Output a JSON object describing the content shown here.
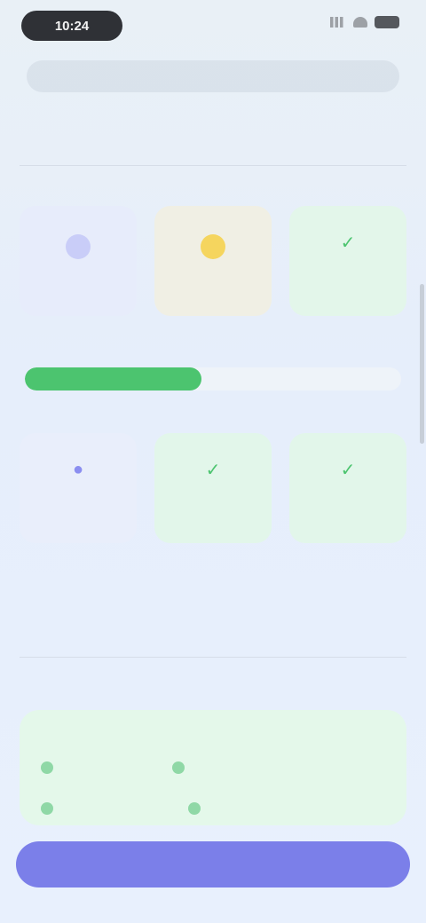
{
  "status_bar": {
    "time": "10:24"
  },
  "browser": {
    "url": ""
  },
  "section1": {
    "title": "",
    "subtitle": "",
    "cards_row1": [
      {
        "badge": "",
        "label": "",
        "accent": "#8b8ef0",
        "bg": "#e7ecfb"
      },
      {
        "badge": "",
        "label": "",
        "accent": "#f3c744",
        "bg": "#f0efe4"
      },
      {
        "icon": "check-icon",
        "label": "",
        "accent": "#6cc98a",
        "bg": "#e3f6ea"
      }
    ],
    "progress": {
      "label": "",
      "value": 0.47,
      "color": "#4cc46f"
    },
    "cards_row2": [
      {
        "icon": "dot-icon",
        "label": "",
        "accent": "#8b8ef0",
        "bg": "#e9eefb"
      },
      {
        "icon": "check-icon",
        "label": "",
        "accent": "#6cc98a",
        "bg": "#e2f6ea"
      },
      {
        "icon": "check-icon",
        "label": "",
        "accent": "#6cc98a",
        "bg": "#e2f6ea"
      }
    ]
  },
  "section2": {
    "title": "",
    "subtitle": "",
    "conditions": {
      "heading": "",
      "items": [
        "",
        "",
        "",
        ""
      ]
    }
  },
  "submit": {
    "label": ""
  },
  "colors": {
    "brand": "#7b7fe9",
    "success": "#4cc46f",
    "warning": "#f3c744"
  }
}
